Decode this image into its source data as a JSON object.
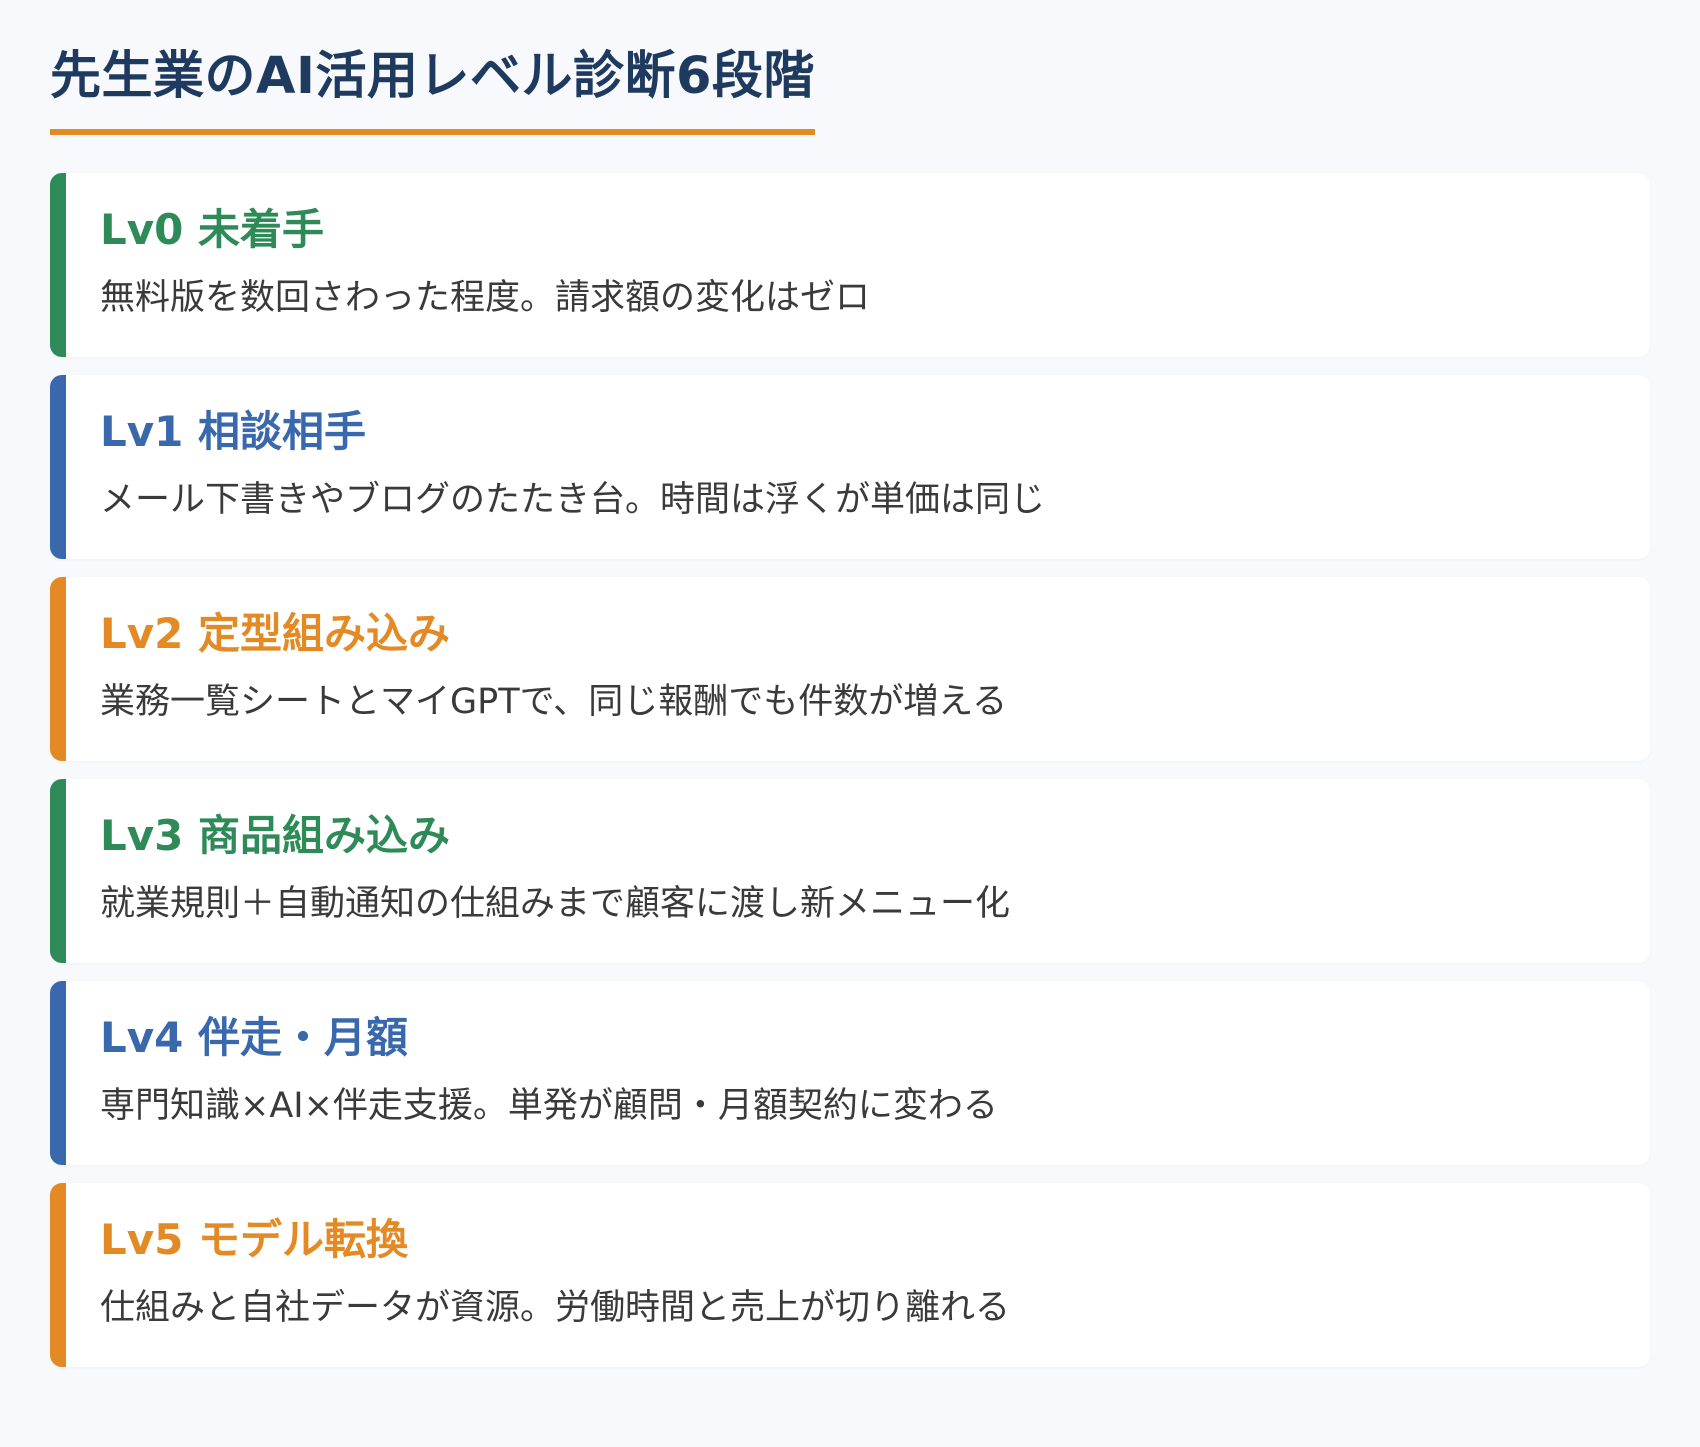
{
  "title": "先生業のAI活用レベル診断6段階",
  "colors": {
    "green": "#2e8b57",
    "blue": "#3a68ad",
    "orange": "#e38a25",
    "title": "#1f3a5f",
    "underline": "#e38a25"
  },
  "levels": [
    {
      "title": "Lv0 未着手",
      "description": "無料版を数回さわった程度。請求額の変化はゼロ",
      "color": "#2e8b57"
    },
    {
      "title": "Lv1 相談相手",
      "description": "メール下書きやブログのたたき台。時間は浮くが単価は同じ",
      "color": "#3a68ad"
    },
    {
      "title": "Lv2 定型組み込み",
      "description": "業務一覧シートとマイGPTで、同じ報酬でも件数が増える",
      "color": "#e38a25"
    },
    {
      "title": "Lv3 商品組み込み",
      "description": "就業規則＋自動通知の仕組みまで顧客に渡し新メニュー化",
      "color": "#2e8b57"
    },
    {
      "title": "Lv4 伴走・月額",
      "description": "専門知識×AI×伴走支援。単発が顧問・月額契約に変わる",
      "color": "#3a68ad"
    },
    {
      "title": "Lv5 モデル転換",
      "description": "仕組みと自社データが資源。労働時間と売上が切り離れる",
      "color": "#e38a25"
    }
  ]
}
